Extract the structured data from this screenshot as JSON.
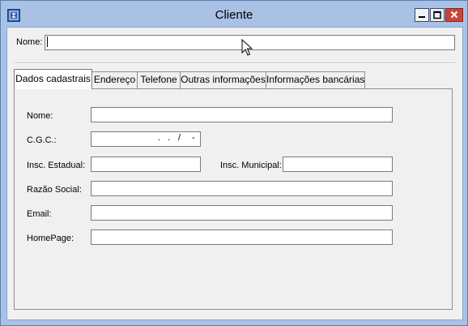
{
  "window": {
    "title": "Cliente",
    "icon": "app-icon",
    "controls": [
      "minimize-icon",
      "maximize-icon",
      "close-icon"
    ]
  },
  "header": {
    "nome_label": "Nome:",
    "nome_value": ""
  },
  "tabs": [
    {
      "label": "Dados cadastrais",
      "active": true
    },
    {
      "label": "Endereço",
      "active": false
    },
    {
      "label": "Telefone",
      "active": false
    },
    {
      "label": "Outras informações",
      "active": false
    },
    {
      "label": "Informações bancárias",
      "active": false
    }
  ],
  "form": {
    "nome_label": "Nome:",
    "nome_value": "",
    "cgc_label": "C.G.C.:",
    "cgc_mask": {
      "dot1": ".",
      "dot2": ".",
      "slash": "/",
      "dash": "-"
    },
    "insc_estadual_label": "Insc. Estadual:",
    "insc_estadual_value": "",
    "insc_municipal_label": "Insc. Municipal:",
    "insc_municipal_value": "",
    "razao_social_label": "Razão Social:",
    "razao_social_value": "",
    "email_label": "Email:",
    "email_value": "",
    "homepage_label": "HomePage:",
    "homepage_value": ""
  },
  "colors": {
    "frame": "#a9c1e4",
    "client": "#f0f0f0",
    "close_button": "#c9453a"
  }
}
